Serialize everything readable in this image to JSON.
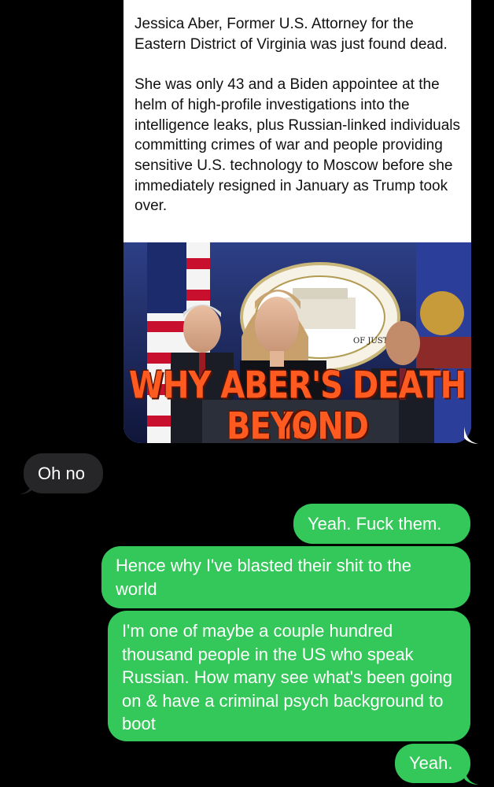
{
  "conversation": {
    "shared_post": {
      "paragraph_1": "Jessica Aber, Former U.S. Attorney for the Eastern District of Virginia was just found dead.",
      "paragraph_2": "She was only 43 and a Biden appointee at the helm of high-profile investigations into the intelligence leaks, plus Russian-linked individuals committing crimes of war and people providing sensitive U.S. technology to Moscow before she immediately resigned in January as Trump took over.",
      "image": {
        "seal_text": "OF JUSTICE",
        "caption_line_1": "WHY ABER'S DEATH IS",
        "caption_line_2": "BEYOND SUSPICIOUS"
      }
    },
    "messages": [
      {
        "direction": "incoming",
        "text": "Oh no"
      },
      {
        "direction": "outgoing",
        "text": "Yeah. Fuck them."
      },
      {
        "direction": "outgoing",
        "text": "Hence why I've blasted their shit to the world"
      },
      {
        "direction": "outgoing",
        "text": "I'm one of maybe a couple hundred thousand people in the US who speak Russian. How many see what's been going on & have a criminal psych background to boot"
      },
      {
        "direction": "outgoing",
        "text": "Yeah."
      }
    ]
  },
  "colors": {
    "background": "#000000",
    "incoming_bubble": "#262629",
    "outgoing_bubble": "#34c759",
    "caption": "#ff5a1f"
  }
}
